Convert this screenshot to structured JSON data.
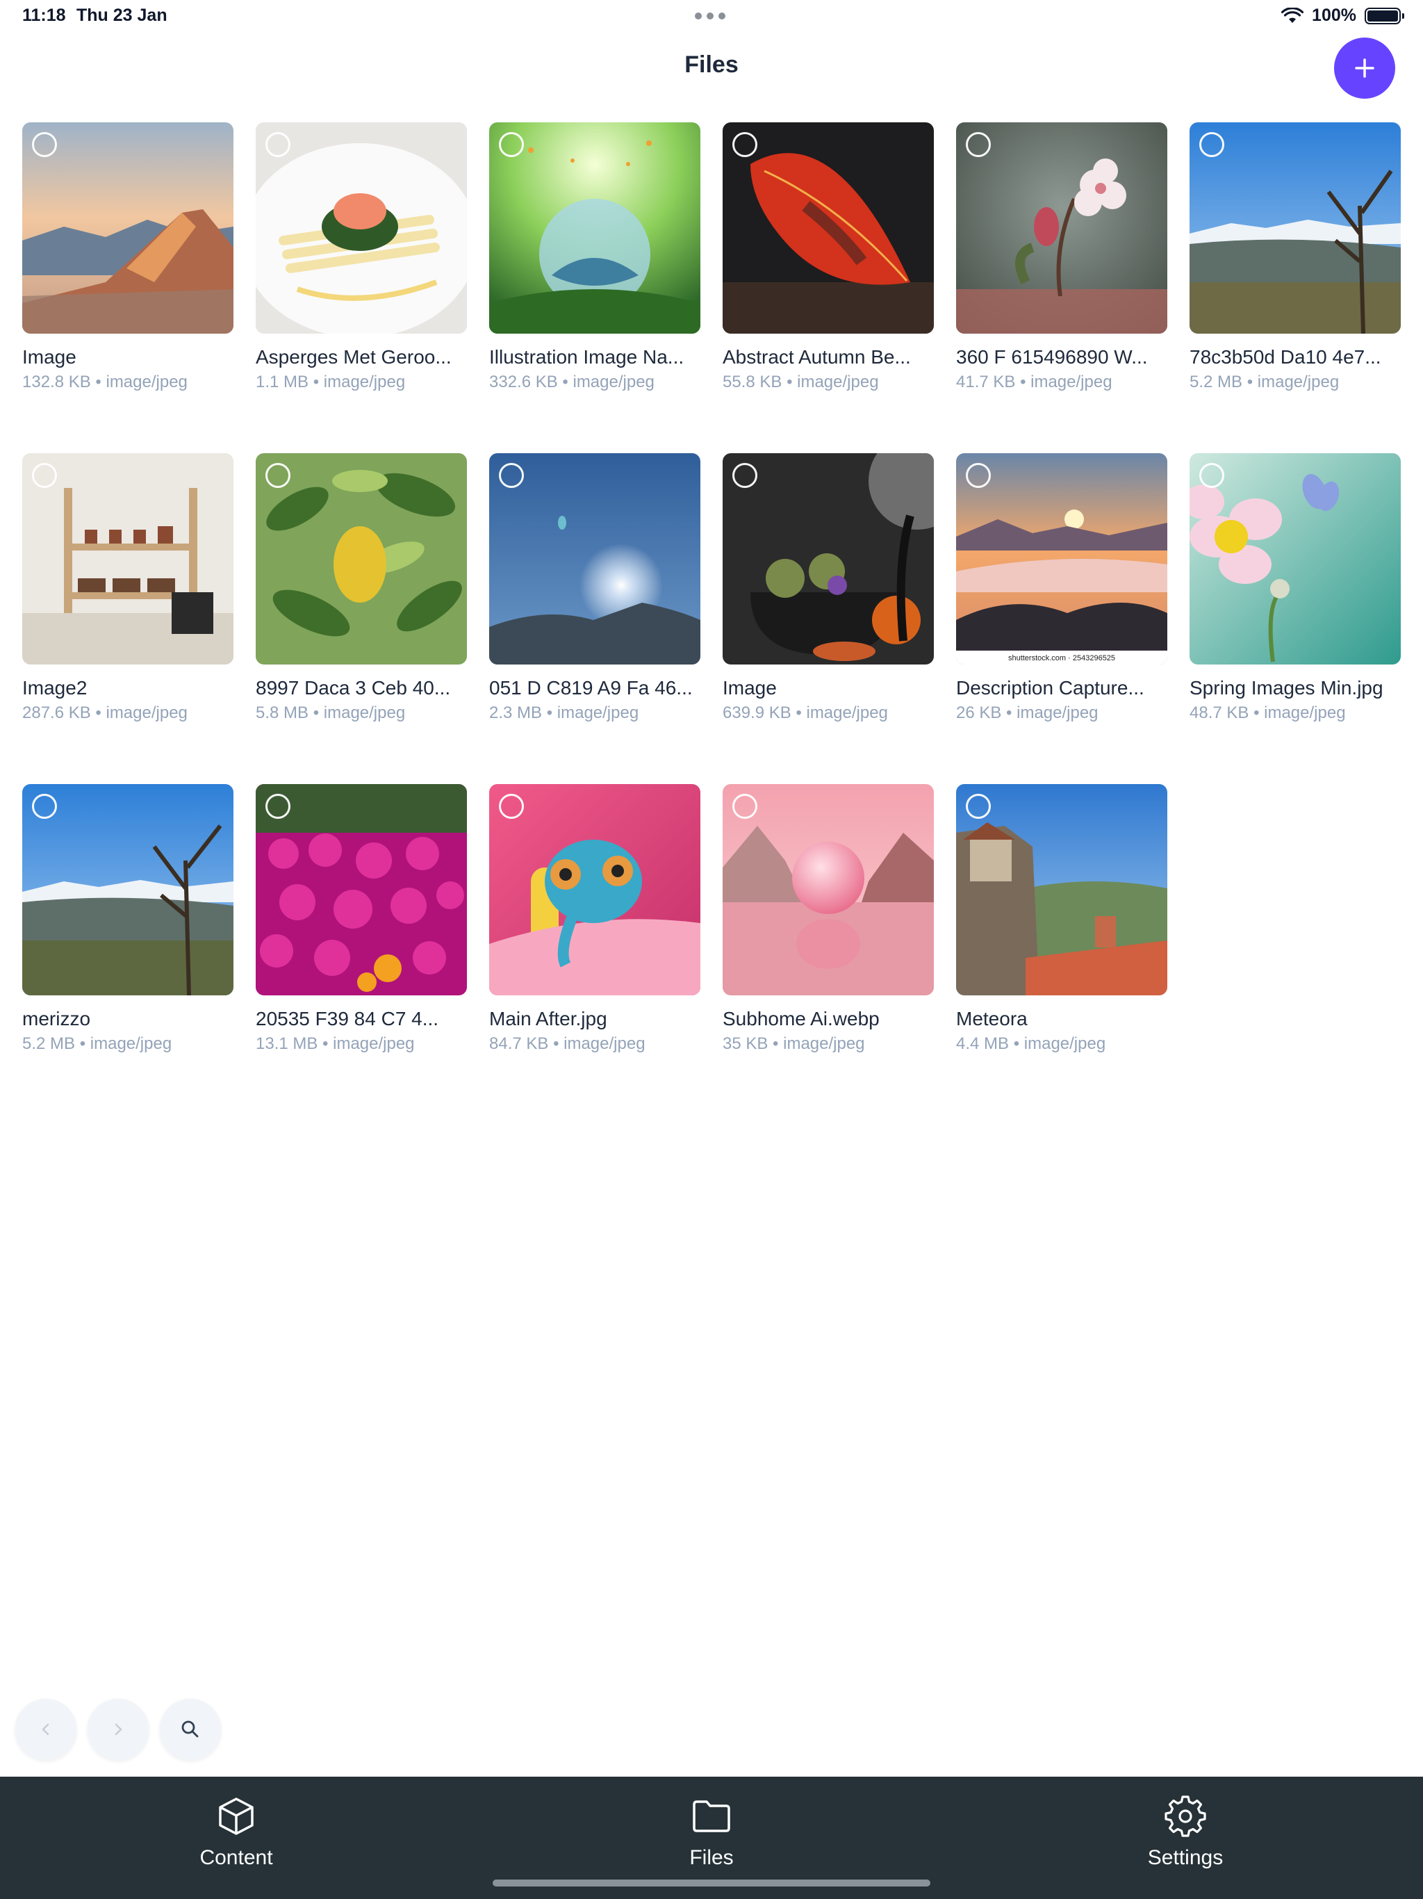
{
  "status_bar": {
    "time": "11:18",
    "date": "Thu 23 Jan",
    "battery": "100%"
  },
  "header": {
    "title": "Files",
    "add_icon": "plus-icon"
  },
  "files": [
    {
      "name": "Image",
      "meta": "132.8 KB • image/jpeg"
    },
    {
      "name": "Asperges Met Geroo...",
      "meta": "1.1 MB • image/jpeg"
    },
    {
      "name": "Illustration Image Na...",
      "meta": "332.6 KB • image/jpeg"
    },
    {
      "name": "Abstract Autumn Be...",
      "meta": "55.8 KB • image/jpeg"
    },
    {
      "name": "360 F 615496890 W...",
      "meta": "41.7 KB • image/jpeg"
    },
    {
      "name": "78c3b50d Da10 4e7...",
      "meta": "5.2 MB • image/jpeg"
    },
    {
      "name": "Image2",
      "meta": "287.6 KB • image/jpeg"
    },
    {
      "name": "8997 Daca 3 Ceb 40...",
      "meta": "5.8 MB • image/jpeg"
    },
    {
      "name": "051 D C819 A9 Fa 46...",
      "meta": "2.3 MB • image/jpeg"
    },
    {
      "name": "Image",
      "meta": "639.9 KB • image/jpeg"
    },
    {
      "name": "Description Capture...",
      "meta": "26 KB • image/jpeg",
      "caption": "shutterstock.com · 2543296525"
    },
    {
      "name": "Spring Images Min.jpg",
      "meta": "48.7 KB • image/jpeg"
    },
    {
      "name": "merizzo",
      "meta": "5.2 MB • image/jpeg"
    },
    {
      "name": "20535 F39 84 C7 4...",
      "meta": "13.1 MB • image/jpeg"
    },
    {
      "name": "Main After.jpg",
      "meta": "84.7 KB • image/jpeg"
    },
    {
      "name": "Subhome Ai.webp",
      "meta": "35 KB • image/jpeg"
    },
    {
      "name": "Meteora",
      "meta": "4.4 MB • image/jpeg"
    }
  ],
  "pager": {
    "prev_icon": "chevron-left-icon",
    "next_icon": "chevron-right-icon",
    "search_icon": "search-icon"
  },
  "nav": [
    {
      "label": "Content",
      "icon": "cube-icon",
      "active": false
    },
    {
      "label": "Files",
      "icon": "folder-icon",
      "active": true
    },
    {
      "label": "Settings",
      "icon": "gear-icon",
      "active": false
    }
  ],
  "colors": {
    "accent": "#6644ff",
    "nav_background": "#263238",
    "meta_text": "#94a3b8"
  }
}
